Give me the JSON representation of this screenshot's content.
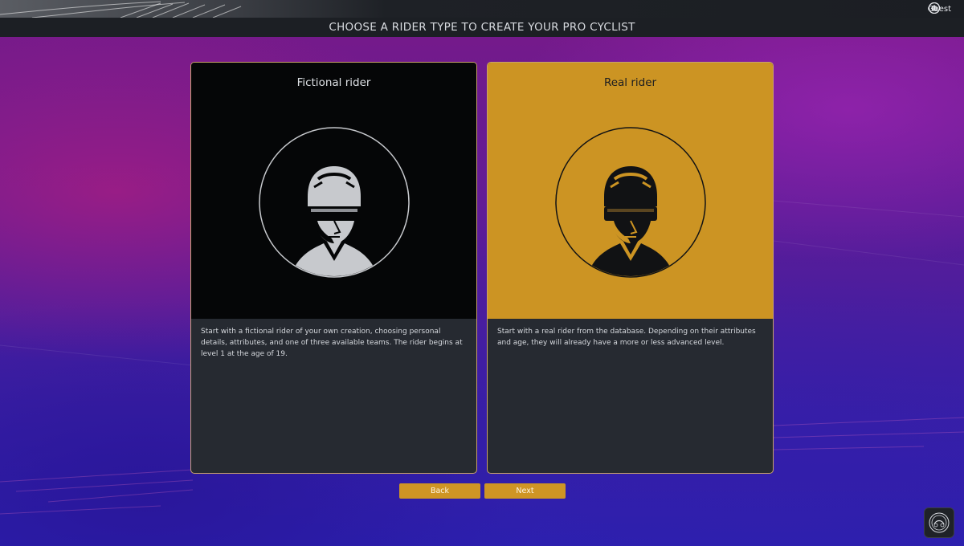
{
  "header": {
    "title": "CHOOSE A RIDER TYPE TO CREATE YOUR PRO CYCLIST",
    "user": "Guest",
    "icons": [
      "home-icon",
      "menu-icon",
      "settings-icon",
      "info-icon",
      "power-icon"
    ]
  },
  "cards": {
    "fictional": {
      "title": "Fictional rider",
      "description": "Start with a fictional rider of your own creation, choosing personal details, attributes, and one of three available teams. The rider begins at level 1 at the age of 19."
    },
    "real": {
      "title": "Real rider",
      "description": "Start with a real rider from the database. Depending on their attributes and age, they will already have a more or less advanced level."
    }
  },
  "buttons": {
    "back": "Back",
    "next": "Next"
  },
  "colors": {
    "accent": "#cc9423",
    "panel": "#262a31",
    "dark_card": "#050607"
  }
}
